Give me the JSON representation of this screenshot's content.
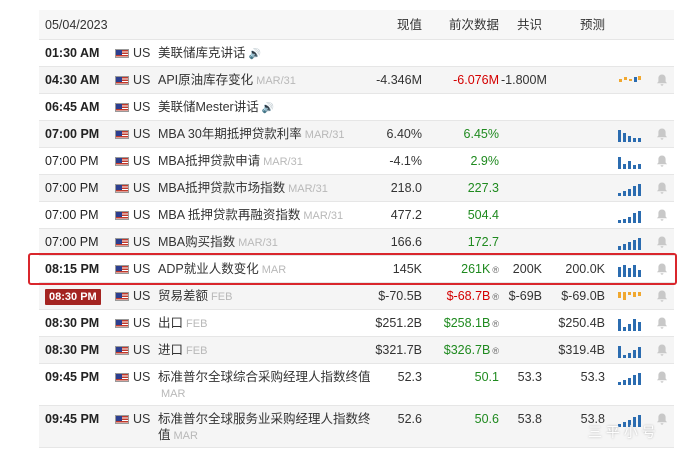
{
  "header": {
    "date": "05/04/2023",
    "actual_label": "现值",
    "previous_label": "前次数据",
    "consensus_label": "共识",
    "forecast_label": "预测"
  },
  "rows": [
    {
      "time": "01:30 AM",
      "country": "US",
      "event": "美联储库克讲话",
      "period": "",
      "actual": "",
      "previous": "",
      "consensus": "",
      "forecast": ""
    },
    {
      "time": "04:30 AM",
      "country": "US",
      "event": "API原油库存变化",
      "period": "MAR/31",
      "actual": "-4.346M",
      "previous": "-6.076M",
      "consensus": "-1.800M",
      "forecast": ""
    },
    {
      "time": "06:45 AM",
      "country": "US",
      "event": "美联储Mester讲话",
      "period": "",
      "actual": "",
      "previous": "",
      "consensus": "",
      "forecast": ""
    },
    {
      "time": "07:00 PM",
      "country": "US",
      "event": "MBA 30年期抵押贷款利率",
      "period": "MAR/31",
      "actual": "6.40%",
      "previous": "6.45%",
      "consensus": "",
      "forecast": ""
    },
    {
      "time": "07:00 PM",
      "country": "US",
      "event": "MBA抵押贷款申请",
      "period": "MAR/31",
      "actual": "-4.1%",
      "previous": "2.9%",
      "consensus": "",
      "forecast": ""
    },
    {
      "time": "07:00 PM",
      "country": "US",
      "event": "MBA抵押贷款市场指数",
      "period": "MAR/31",
      "actual": "218.0",
      "previous": "227.3",
      "consensus": "",
      "forecast": ""
    },
    {
      "time": "07:00 PM",
      "country": "US",
      "event": "MBA 抵押贷款再融资指数",
      "period": "MAR/31",
      "actual": "477.2",
      "previous": "504.4",
      "consensus": "",
      "forecast": ""
    },
    {
      "time": "07:00 PM",
      "country": "US",
      "event": "MBA购买指数",
      "period": "MAR/31",
      "actual": "166.6",
      "previous": "172.7",
      "consensus": "",
      "forecast": ""
    },
    {
      "time": "08:15 PM",
      "country": "US",
      "event": "ADP就业人数变化",
      "period": "MAR",
      "actual": "145K",
      "previous": "261K",
      "consensus": "200K",
      "forecast": "200.0K"
    },
    {
      "time": "08:30 PM",
      "country": "US",
      "event": "贸易差额",
      "period": "FEB",
      "actual": "$-70.5B",
      "previous": "$-68.7B",
      "consensus": "$-69B",
      "forecast": "$-69.0B"
    },
    {
      "time": "08:30 PM",
      "country": "US",
      "event": "出口",
      "period": "FEB",
      "actual": "$251.2B",
      "previous": "$258.1B",
      "consensus": "",
      "forecast": "$250.4B"
    },
    {
      "time": "08:30 PM",
      "country": "US",
      "event": "进口",
      "period": "FEB",
      "actual": "$321.7B",
      "previous": "$326.7B",
      "consensus": "",
      "forecast": "$319.4B"
    },
    {
      "time": "09:45 PM",
      "country": "US",
      "event": "标准普尔全球综合采购经理人指数终值",
      "period": "MAR",
      "actual": "52.3",
      "previous": "50.1",
      "consensus": "53.3",
      "forecast": "53.3"
    },
    {
      "time": "09:45 PM",
      "country": "US",
      "event": "标准普尔全球服务业采购经理人指数终值",
      "period": "MAR",
      "actual": "52.6",
      "previous": "50.6",
      "consensus": "53.8",
      "forecast": "53.8"
    }
  ],
  "revised_mark": "®",
  "sound_icon": "🔊",
  "watermark": "三 平 小 号",
  "colors": {
    "green": "#1f8a1f",
    "red": "#d40000",
    "bar_blue": "#2b6cb0",
    "bar_orange": "#f0a830",
    "highlight": "#d9262c",
    "badge": "#a42421"
  }
}
